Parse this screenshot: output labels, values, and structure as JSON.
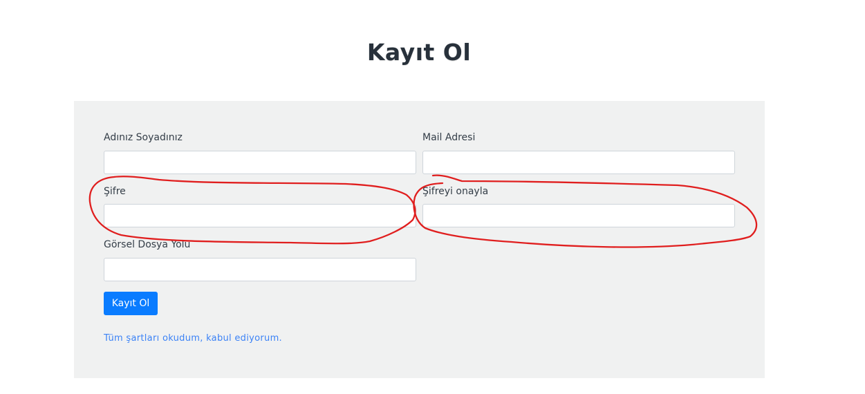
{
  "page": {
    "title": "Kayıt Ol"
  },
  "form": {
    "full_name": {
      "label": "Adınız Soyadınız",
      "value": "",
      "placeholder": ""
    },
    "email": {
      "label": "Mail Adresi",
      "value": "",
      "placeholder": ""
    },
    "password": {
      "label": "Şifre",
      "value": "",
      "placeholder": ""
    },
    "password_confirm": {
      "label": "Şifreyi onayla",
      "value": "",
      "placeholder": ""
    },
    "image_path": {
      "label": "Görsel Dosya Yolu",
      "value": "",
      "placeholder": ""
    },
    "submit_label": "Kayıt Ol",
    "terms_text": "Tüm şartları okudum, kabul ediyorum."
  },
  "colors": {
    "panel_background": "#f0f1f1",
    "primary_button": "#0a7cff",
    "link": "#3b82f6",
    "annotation": "#e01e1e"
  }
}
